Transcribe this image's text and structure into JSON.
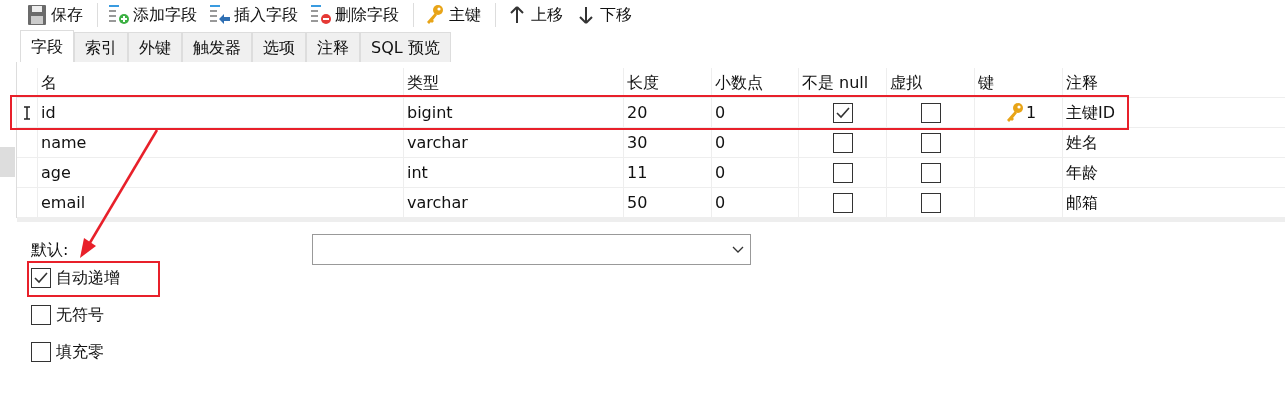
{
  "toolbar": [
    {
      "kind": "save",
      "label": "保存"
    },
    {
      "kind": "add",
      "label": "添加字段"
    },
    {
      "kind": "insert",
      "label": "插入字段"
    },
    {
      "kind": "delete",
      "label": "删除字段"
    },
    {
      "kind": "key",
      "label": "主键"
    },
    {
      "kind": "up",
      "label": "上移"
    },
    {
      "kind": "down",
      "label": "下移"
    }
  ],
  "tabs": [
    {
      "label": "字段",
      "selected": true
    },
    {
      "label": "索引",
      "selected": false
    },
    {
      "label": "外键",
      "selected": false
    },
    {
      "label": "触发器",
      "selected": false
    },
    {
      "label": "选项",
      "selected": false
    },
    {
      "label": "注释",
      "selected": false
    },
    {
      "label": "SQL 预览",
      "selected": false
    }
  ],
  "table": {
    "columns": [
      "名",
      "类型",
      "长度",
      "小数点",
      "不是 null",
      "虚拟",
      "键",
      "注释"
    ],
    "rows": [
      {
        "current": true,
        "name": "id",
        "type": "bigint",
        "length": "20",
        "decimals": "0",
        "not_null": true,
        "virtual": false,
        "key": "1",
        "comment": "主键ID"
      },
      {
        "current": false,
        "name": "name",
        "type": "varchar",
        "length": "30",
        "decimals": "0",
        "not_null": false,
        "virtual": false,
        "comment": "姓名"
      },
      {
        "current": false,
        "name": "age",
        "type": "int",
        "length": "11",
        "decimals": "0",
        "not_null": false,
        "virtual": false,
        "comment": "年龄"
      },
      {
        "current": false,
        "name": "email",
        "type": "varchar",
        "length": "50",
        "decimals": "0",
        "not_null": false,
        "virtual": false,
        "comment": "邮箱"
      }
    ]
  },
  "options": {
    "default_label": "默认:",
    "checkboxes": [
      {
        "label": "自动递增",
        "checked": true
      },
      {
        "label": "无符号",
        "checked": false
      },
      {
        "label": "填充零",
        "checked": false
      }
    ]
  },
  "annotations": [
    {
      "kind": "frame"
    },
    {
      "kind": "frame"
    },
    {
      "kind": "arrow"
    }
  ]
}
